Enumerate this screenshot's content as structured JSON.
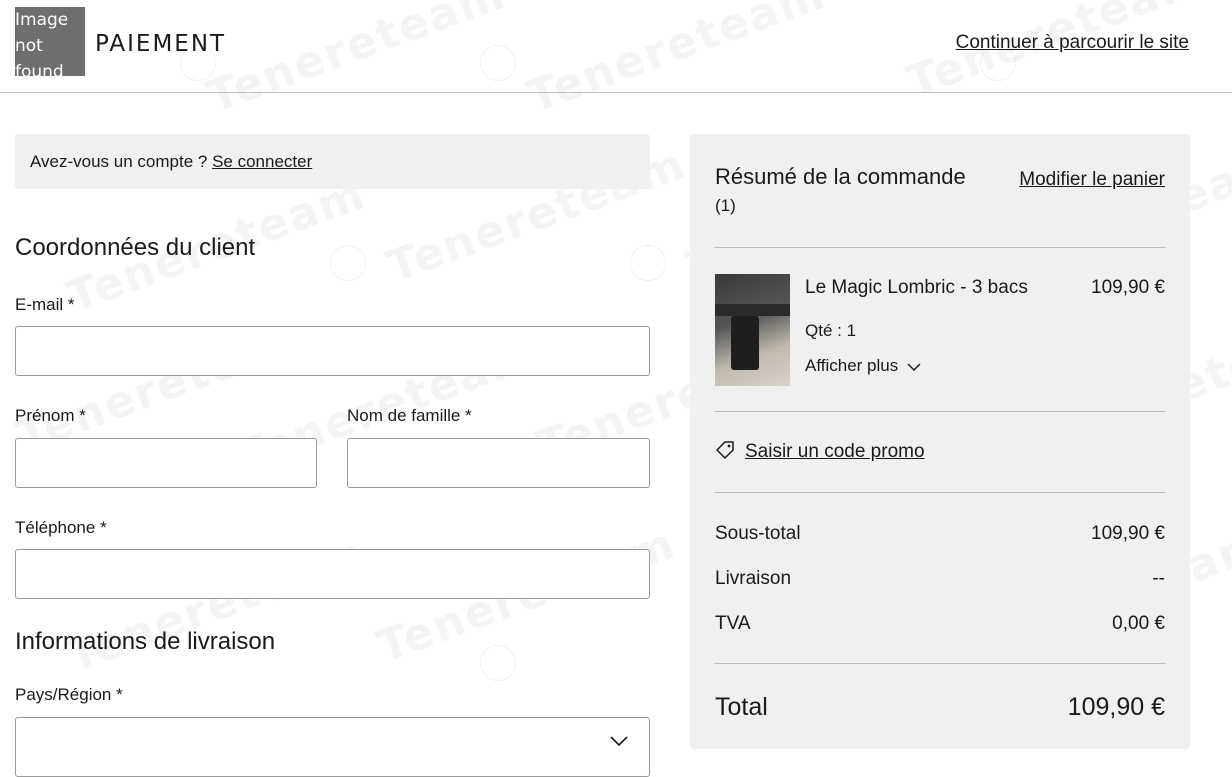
{
  "header": {
    "logo_lines": [
      "Image",
      "not",
      "found"
    ],
    "title": "PAIEMENT",
    "continue_link": "Continuer à parcourir le site"
  },
  "account": {
    "question": "Avez-vous un compte ? ",
    "login_link": "Se connecter"
  },
  "customer": {
    "title": "Coordonnées du client",
    "email_label": "E-mail *",
    "firstname_label": "Prénom *",
    "lastname_label": "Nom de famille *",
    "phone_label": "Téléphone *"
  },
  "shipping": {
    "title": "Informations de livraison",
    "country_label": "Pays/Région *"
  },
  "summary": {
    "title": "Résumé de la commande",
    "count": "(1)",
    "edit_cart": "Modifier le panier",
    "product": {
      "name": "Le Magic Lombric - 3 bacs",
      "price": "109,90 €",
      "qty": "Qté : 1",
      "show_more": "Afficher plus"
    },
    "promo": "Saisir un code promo",
    "subtotal_label": "Sous-total",
    "subtotal_value": "109,90 €",
    "delivery_label": "Livraison",
    "delivery_value": "--",
    "vat_label": "TVA",
    "vat_value": "0,00 €",
    "total_label": "Total",
    "total_value": "109,90 €"
  },
  "watermark": "Tenereteam",
  "icons": {
    "tag": "tag-icon",
    "chevron": "chevron-down-icon"
  }
}
